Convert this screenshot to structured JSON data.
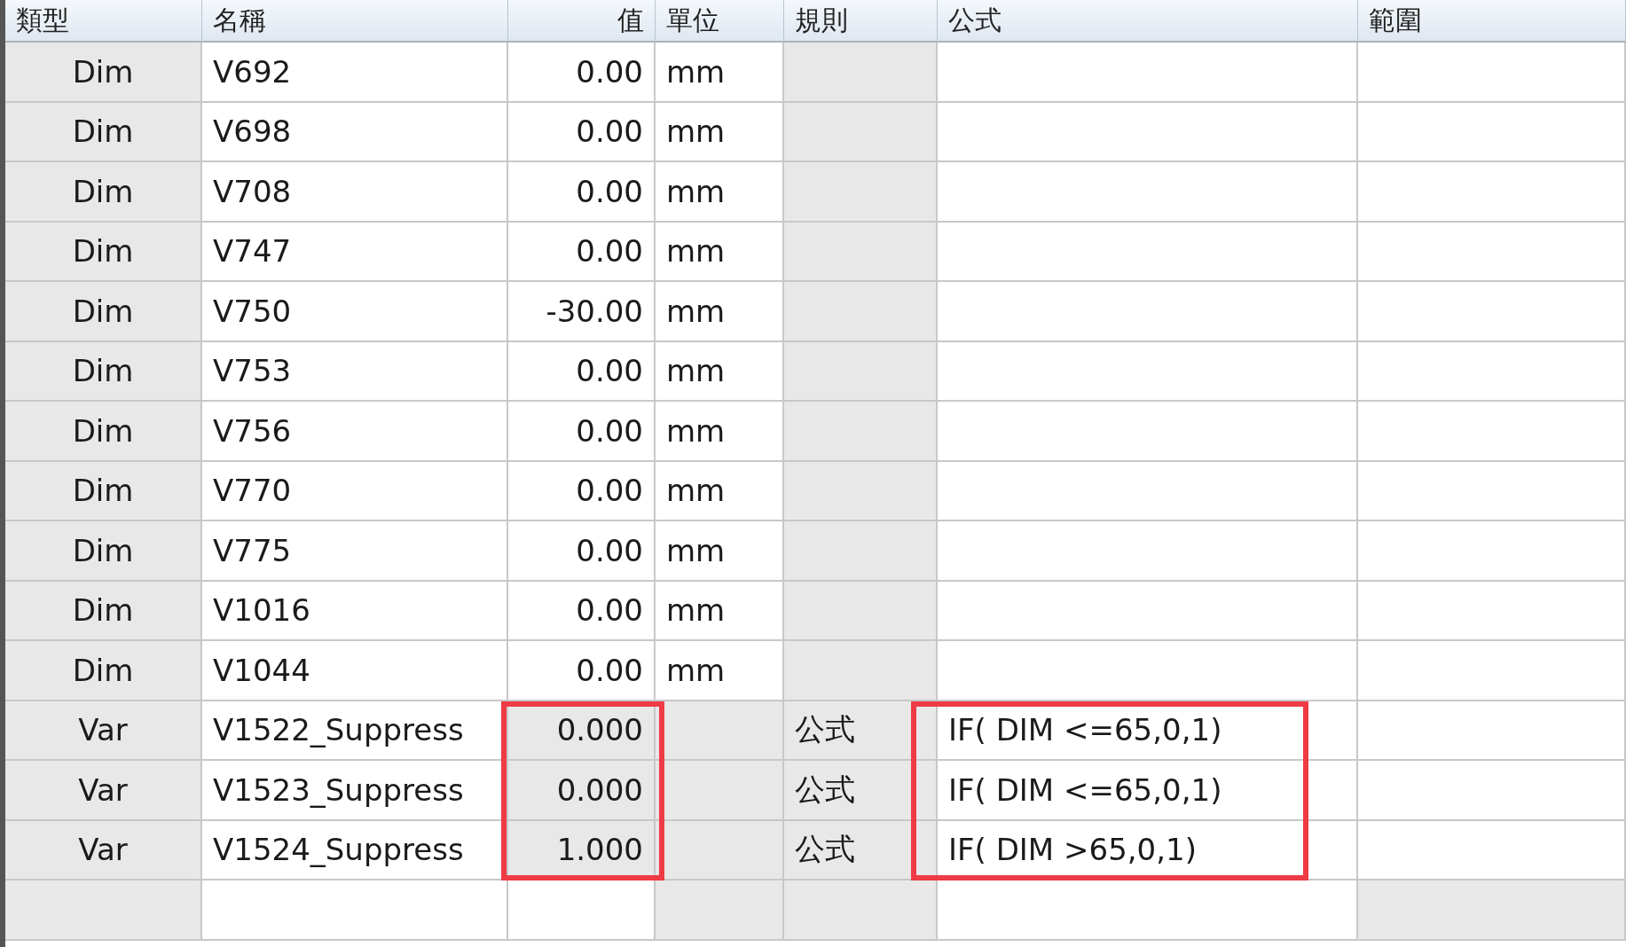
{
  "columns": [
    "類型",
    "名稱",
    "值",
    "單位",
    "規則",
    "公式",
    "範圍"
  ],
  "rows": [
    {
      "kind": "dim",
      "type": "Dim",
      "name": "V692",
      "value": "0.00",
      "unit": "mm",
      "highlighted": false
    },
    {
      "kind": "dim",
      "type": "Dim",
      "name": "V698",
      "value": "0.00",
      "unit": "mm",
      "highlighted": false
    },
    {
      "kind": "dim",
      "type": "Dim",
      "name": "V708",
      "value": "0.00",
      "unit": "mm",
      "highlighted": false
    },
    {
      "kind": "dim",
      "type": "Dim",
      "name": "V747",
      "value": "0.00",
      "unit": "mm",
      "highlighted": false
    },
    {
      "kind": "dim",
      "type": "Dim",
      "name": "V750",
      "value": "-30.00",
      "unit": "mm",
      "highlighted": false
    },
    {
      "kind": "dim",
      "type": "Dim",
      "name": "V753",
      "value": "0.00",
      "unit": "mm",
      "highlighted": false
    },
    {
      "kind": "dim",
      "type": "Dim",
      "name": "V756",
      "value": "0.00",
      "unit": "mm",
      "highlighted": false
    },
    {
      "kind": "dim",
      "type": "Dim",
      "name": "V770",
      "value": "0.00",
      "unit": "mm",
      "highlighted": false
    },
    {
      "kind": "dim",
      "type": "Dim",
      "name": "V775",
      "value": "0.00",
      "unit": "mm",
      "highlighted": false
    },
    {
      "kind": "dim",
      "type": "Dim",
      "name": "V1016",
      "value": "0.00",
      "unit": "mm",
      "highlighted": false
    },
    {
      "kind": "dim",
      "type": "Dim",
      "name": "V1044",
      "value": "0.00",
      "unit": "mm",
      "highlighted": false
    },
    {
      "kind": "var",
      "type": "Var",
      "name": "V1522_Suppress",
      "value": "0.000",
      "rule": "公式",
      "formula": "IF( DIM <=65,0,1)",
      "highlighted": true
    },
    {
      "kind": "var",
      "type": "Var",
      "name": "V1523_Suppress",
      "value": "0.000",
      "rule": "公式",
      "formula": "IF( DIM <=65,0,1)",
      "highlighted": true
    },
    {
      "kind": "var",
      "type": "Var",
      "name": "V1524_Suppress",
      "value": "1.000",
      "rule": "公式",
      "formula": "IF( DIM >65,0,1)",
      "highlighted": true
    },
    {
      "kind": "blank",
      "highlighted": false
    }
  ]
}
